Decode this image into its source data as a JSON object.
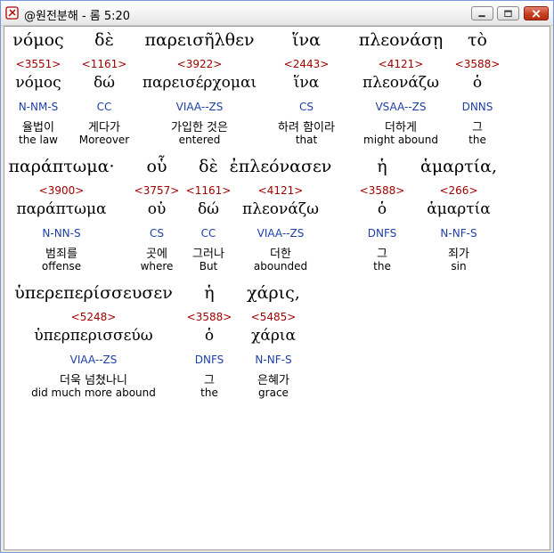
{
  "window": {
    "title": "@원전분해 - 롬 5:20",
    "controls": {
      "minimize": "minimize",
      "maximize": "maximize",
      "close": "close"
    }
  },
  "colors": {
    "strong": "#a00000",
    "parsing": "#1f3fa8",
    "text": "#000000"
  },
  "words": [
    {
      "greek": "νόμος",
      "strong": "<3551>",
      "lemma": "νόμος",
      "parsing": "N-NM-S",
      "korean": "율법이",
      "english": "the law"
    },
    {
      "greek": "δὲ",
      "strong": "<1161>",
      "lemma": "δώ",
      "parsing": "CC",
      "korean": "게다가",
      "english": "Moreover"
    },
    {
      "greek": "παρεισῆλθεν",
      "strong": "<3922>",
      "lemma": "παρεισέρχομαι",
      "parsing": "VIAA--ZS",
      "korean": "가입한 것은",
      "english": "entered"
    },
    {
      "greek": "ἵνα",
      "strong": "<2443>",
      "lemma": "ἵνα",
      "parsing": "CS",
      "korean": "하려 함이라",
      "english": "that"
    },
    {
      "greek": "πλεονάσῃ",
      "strong": "<4121>",
      "lemma": "πλεονάζω",
      "parsing": "VSAA--ZS",
      "korean": "더하게",
      "english": "might abound"
    },
    {
      "greek": "τὸ",
      "strong": "<3588>",
      "lemma": "ὁ",
      "parsing": "DNNS",
      "korean": "그",
      "english": "the"
    },
    {
      "greek": "παράπτωμα·",
      "strong": "<3900>",
      "lemma": "παράπτωμα",
      "parsing": "N-NN-S",
      "korean": "범죄를",
      "english": "offense"
    },
    {
      "greek": "οὗ",
      "strong": "<3757>",
      "lemma": "οὑ",
      "parsing": "CS",
      "korean": "곳에",
      "english": "where"
    },
    {
      "greek": "δὲ",
      "strong": "<1161>",
      "lemma": "δώ",
      "parsing": "CC",
      "korean": "그러나",
      "english": "But"
    },
    {
      "greek": "ἐπλεόνασεν",
      "strong": "<4121>",
      "lemma": "πλεονάζω",
      "parsing": "VIAA--ZS",
      "korean": "더한",
      "english": "abounded"
    },
    {
      "greek": "ἡ",
      "strong": "<3588>",
      "lemma": "ὁ",
      "parsing": "DNFS",
      "korean": "그",
      "english": "the"
    },
    {
      "greek": "ἁμαρτία,",
      "strong": "<266>",
      "lemma": "ἁμαρτία",
      "parsing": "N-NF-S",
      "korean": "죄가",
      "english": "sin"
    },
    {
      "greek": "ὑπερεπερίσσευσεν",
      "strong": "<5248>",
      "lemma": "ὑπερπερισσεύω",
      "parsing": "VIAA--ZS",
      "korean": "더욱 넘쳤나니",
      "english": "did much more abound"
    },
    {
      "greek": "ἡ",
      "strong": "<3588>",
      "lemma": "ὁ",
      "parsing": "DNFS",
      "korean": "그",
      "english": "the"
    },
    {
      "greek": "χάρις,",
      "strong": "<5485>",
      "lemma": "χάρια",
      "parsing": "N-NF-S",
      "korean": "은혜가",
      "english": "grace"
    }
  ]
}
